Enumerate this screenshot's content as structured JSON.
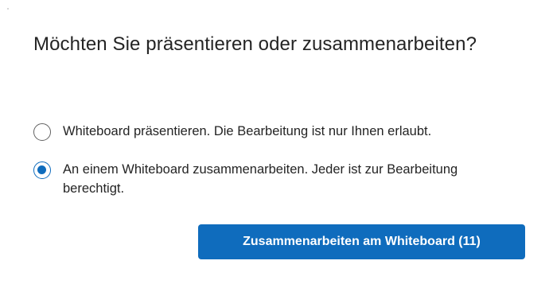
{
  "dialog": {
    "title": "Möchten Sie präsentieren oder zusammenarbeiten?",
    "options": [
      {
        "label": "Whiteboard präsentieren. Die Bearbeitung ist nur Ihnen erlaubt.",
        "selected": false
      },
      {
        "label": "An einem Whiteboard zusammenarbeiten. Jeder ist zur Bearbeitung berechtigt.",
        "selected": true
      }
    ],
    "primary_button_label": "Zusammenarbeiten am Whiteboard (11)"
  },
  "colors": {
    "accent": "#0f6cbd",
    "text": "#242424",
    "radio_border": "#616161"
  }
}
